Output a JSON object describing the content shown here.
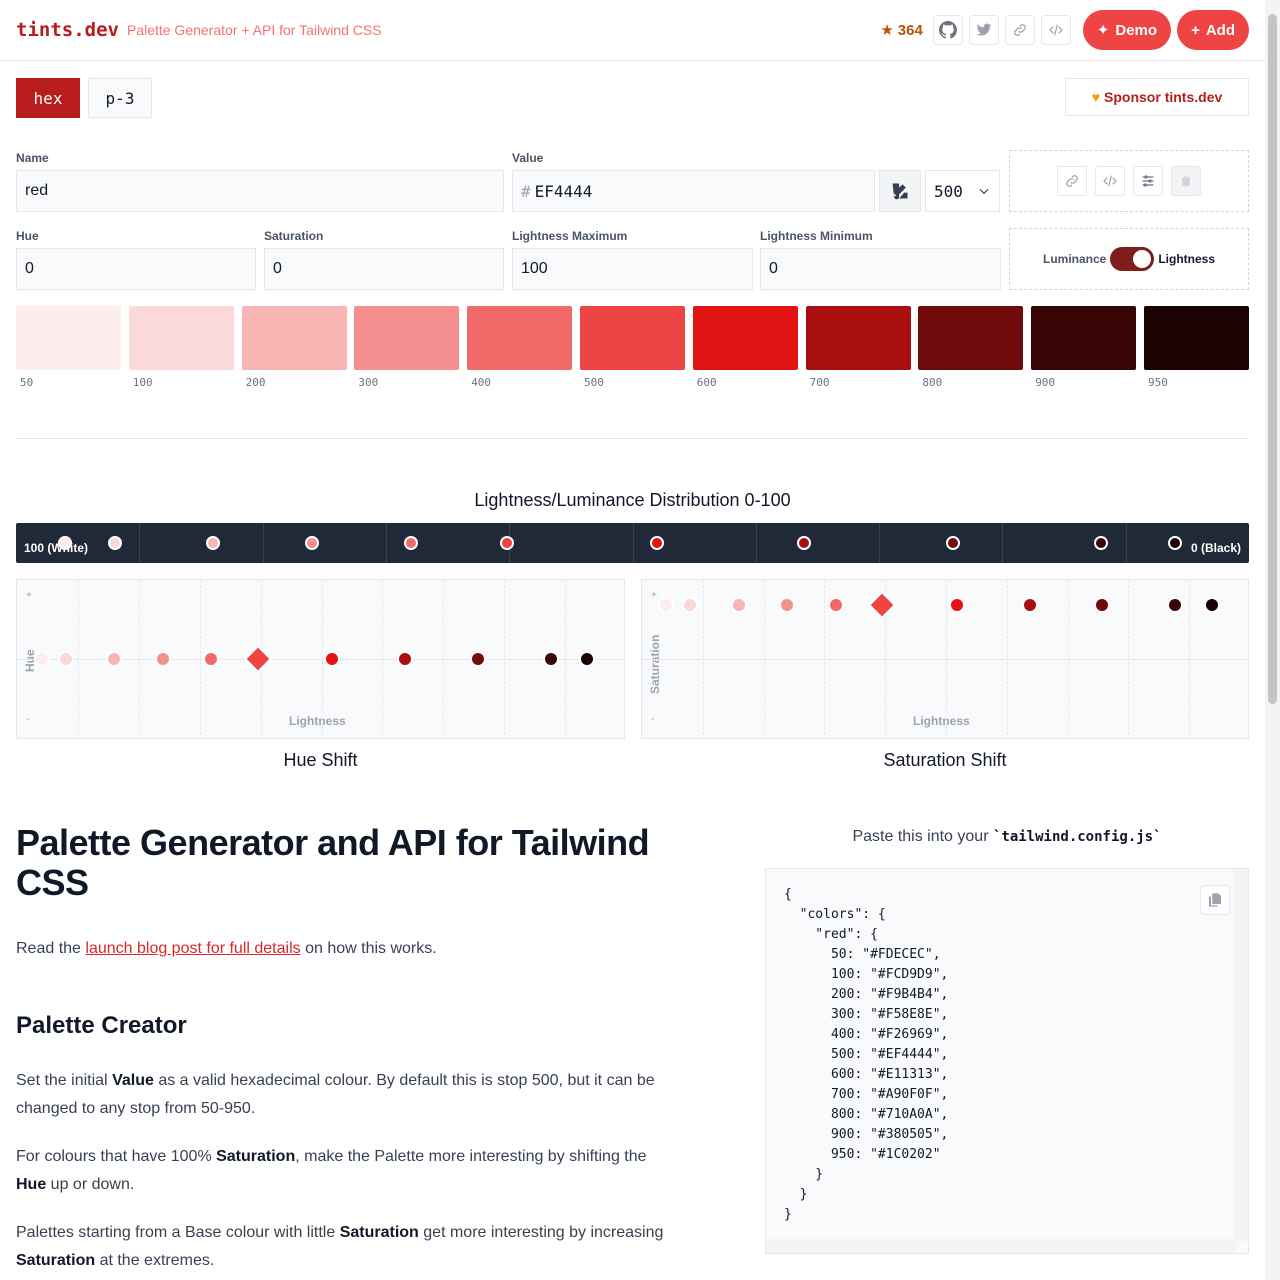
{
  "header": {
    "brand": "tints.dev",
    "tagline": "Palette Generator + API for Tailwind CSS",
    "stars": "364",
    "demo_label": "Demo",
    "add_label": "Add"
  },
  "mode_tabs": [
    "hex",
    "p-3"
  ],
  "sponsor_label": "Sponsor tints.dev",
  "form": {
    "name_label": "Name",
    "name_value": "red",
    "value_label": "Value",
    "hash": "#",
    "value_value": "EF4444",
    "stop_value": "500",
    "hue_label": "Hue",
    "hue_value": "0",
    "saturation_label": "Saturation",
    "saturation_value": "0",
    "lmax_label": "Lightness Maximum",
    "lmax_value": "100",
    "lmin_label": "Lightness Minimum",
    "lmin_value": "0",
    "toggle_left": "Luminance",
    "toggle_right": "Lightness"
  },
  "swatches": [
    {
      "stop": "50",
      "color": "#FDECEC"
    },
    {
      "stop": "100",
      "color": "#FCD9D9"
    },
    {
      "stop": "200",
      "color": "#F9B4B4"
    },
    {
      "stop": "300",
      "color": "#F58E8E"
    },
    {
      "stop": "400",
      "color": "#F26969"
    },
    {
      "stop": "500",
      "color": "#EF4444"
    },
    {
      "stop": "600",
      "color": "#E11313"
    },
    {
      "stop": "700",
      "color": "#A90F0F"
    },
    {
      "stop": "800",
      "color": "#710A0A"
    },
    {
      "stop": "900",
      "color": "#380505"
    },
    {
      "stop": "950",
      "color": "#1C0202"
    }
  ],
  "distribution": {
    "title": "Lightness/Luminance Distribution 0-100",
    "left_label": "100 (White)",
    "right_label": "0 (Black)"
  },
  "hue_graph": {
    "title": "Hue Shift",
    "y_label": "Hue",
    "x_label": "Lightness",
    "plus": "+",
    "minus": "-"
  },
  "sat_graph": {
    "title": "Saturation Shift",
    "y_label": "Saturation",
    "x_label": "Lightness",
    "plus": "+",
    "minus": "-"
  },
  "article": {
    "h1": "Palette Generator and API for Tailwind CSS",
    "intro_before": "Read the ",
    "intro_link": "launch blog post for full details",
    "intro_after": " on how this works.",
    "h2": "Palette Creator",
    "p1_a": "Set the initial ",
    "p1_b": "Value",
    "p1_c": " as a valid hexadecimal colour. By default this is stop 500, but it can be changed to any stop from 50-950.",
    "p2_a": "For colours that have 100% ",
    "p2_b": "Saturation",
    "p2_c": ", make the Palette more interesting by shifting the ",
    "p2_d": "Hue",
    "p2_e": " up or down.",
    "p3_a": "Palettes starting from a Base colour with little ",
    "p3_b": "Saturation",
    "p3_c": " get more interesting by increasing ",
    "p3_d": "Saturation",
    "p3_e": " at the extremes."
  },
  "code": {
    "paste_before": "Paste this into your ",
    "paste_code": "`tailwind.config.js`",
    "lines": [
      "{",
      "  \"colors\": {",
      "    \"red\": {",
      "      50: \"#FDECEC\",",
      "      100: \"#FCD9D9\",",
      "      200: \"#F9B4B4\",",
      "      300: \"#F58E8E\",",
      "      400: \"#F26969\",",
      "      500: \"#EF4444\",",
      "      600: \"#E11313\",",
      "      700: \"#A90F0F\",",
      "      800: \"#710A0A\",",
      "      900: \"#380505\",",
      "      950: \"#1C0202\"",
      "    }",
      "  }",
      "}"
    ]
  }
}
